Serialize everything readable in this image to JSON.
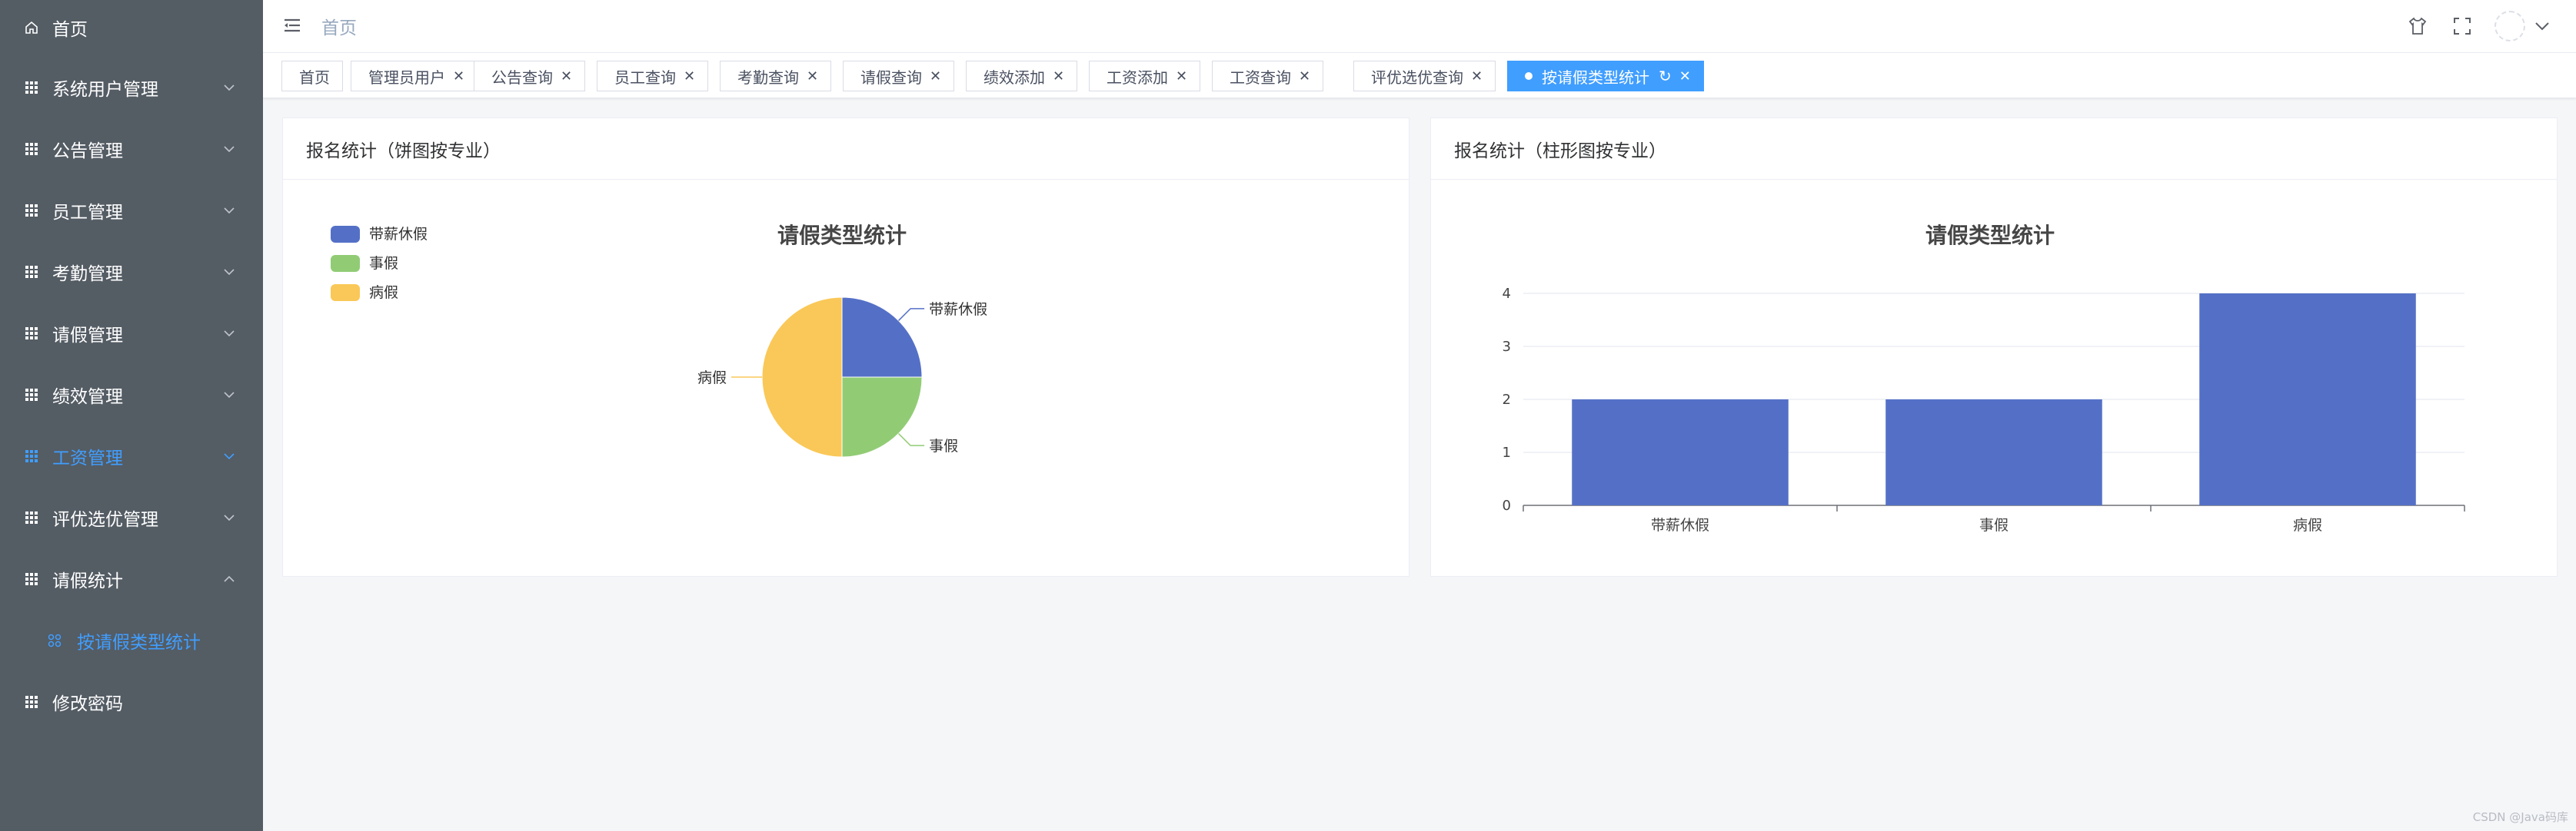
{
  "sidebar": {
    "items": [
      {
        "label": "首页",
        "icon": "home-icon",
        "arrow": ""
      },
      {
        "label": "系统用户管理",
        "icon": "grid-icon",
        "arrow": "down"
      },
      {
        "label": "公告管理",
        "icon": "grid-icon",
        "arrow": "down"
      },
      {
        "label": "员工管理",
        "icon": "grid-icon",
        "arrow": "down"
      },
      {
        "label": "考勤管理",
        "icon": "grid-icon",
        "arrow": "down"
      },
      {
        "label": "请假管理",
        "icon": "grid-icon",
        "arrow": "down"
      },
      {
        "label": "绩效管理",
        "icon": "grid-icon",
        "arrow": "down"
      },
      {
        "label": "工资管理",
        "icon": "grid-icon",
        "arrow": "down"
      },
      {
        "label": "评优选优管理",
        "icon": "grid-icon",
        "arrow": "down"
      },
      {
        "label": "请假统计",
        "icon": "grid-icon",
        "arrow": "up"
      },
      {
        "label": "按请假类型统计",
        "icon": "apps-icon",
        "arrow": ""
      },
      {
        "label": "修改密码",
        "icon": "grid-icon",
        "arrow": ""
      }
    ]
  },
  "header": {
    "breadcrumb": "首页",
    "icons": [
      "shirt-icon",
      "fullscreen-icon",
      "avatar",
      "chevron-down-icon"
    ]
  },
  "tags": [
    {
      "label": "首页"
    },
    {
      "label": "管理员用户"
    },
    {
      "label": "公告查询"
    },
    {
      "label": "员工查询"
    },
    {
      "label": "考勤查询"
    },
    {
      "label": "请假查询"
    },
    {
      "label": "绩效添加"
    },
    {
      "label": "工资添加"
    },
    {
      "label": "工资查询"
    },
    {
      "label": "评优选优查询"
    },
    {
      "label": "按请假类型统计"
    }
  ],
  "colors": {
    "sidebar_bg": "#545c64",
    "accent": "#409eff",
    "series": [
      "#5470c6",
      "#91cc75",
      "#fac858"
    ]
  },
  "cards": {
    "pie_title": "报名统计（饼图按专业）",
    "bar_title": "报名统计（柱形图按专业）"
  },
  "chart_data": [
    {
      "type": "pie",
      "title": "请假类型统计",
      "legend_position": "top-left",
      "categories": [
        "带薪休假",
        "事假",
        "病假"
      ],
      "values": [
        2,
        2,
        4
      ]
    },
    {
      "type": "bar",
      "title": "请假类型统计",
      "categories": [
        "带薪休假",
        "事假",
        "病假"
      ],
      "values": [
        2,
        2,
        4
      ],
      "ylim": [
        0,
        4
      ],
      "yticks": [
        "0",
        "1",
        "2",
        "3",
        "4"
      ],
      "grid": true
    }
  ],
  "watermark": "CSDN @Java码库"
}
